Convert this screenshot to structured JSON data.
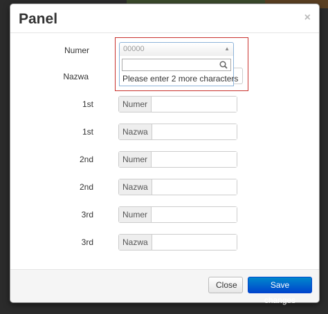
{
  "modal": {
    "title": "Panel",
    "close_glyph": "×"
  },
  "top_fields": {
    "numer_label": "Numer",
    "nazwa_label": "Nazwa"
  },
  "select2": {
    "value": "00000",
    "arrow_glyph": "▲",
    "search_placeholder": "",
    "message": "Please enter 2 more characters"
  },
  "rows": [
    {
      "label": "1st",
      "addon": "Numer",
      "value": ""
    },
    {
      "label": "1st",
      "addon": "Nazwa",
      "value": ""
    },
    {
      "label": "2nd",
      "addon": "Numer",
      "value": ""
    },
    {
      "label": "2nd",
      "addon": "Nazwa",
      "value": ""
    },
    {
      "label": "3rd",
      "addon": "Numer",
      "value": ""
    },
    {
      "label": "3rd",
      "addon": "Nazwa",
      "value": ""
    }
  ],
  "footer": {
    "close_label": "Close",
    "save_label": "Save changes"
  },
  "colors": {
    "primary": "#0088cc",
    "highlight_border": "#c9302c",
    "select_border": "#8db3d9"
  }
}
